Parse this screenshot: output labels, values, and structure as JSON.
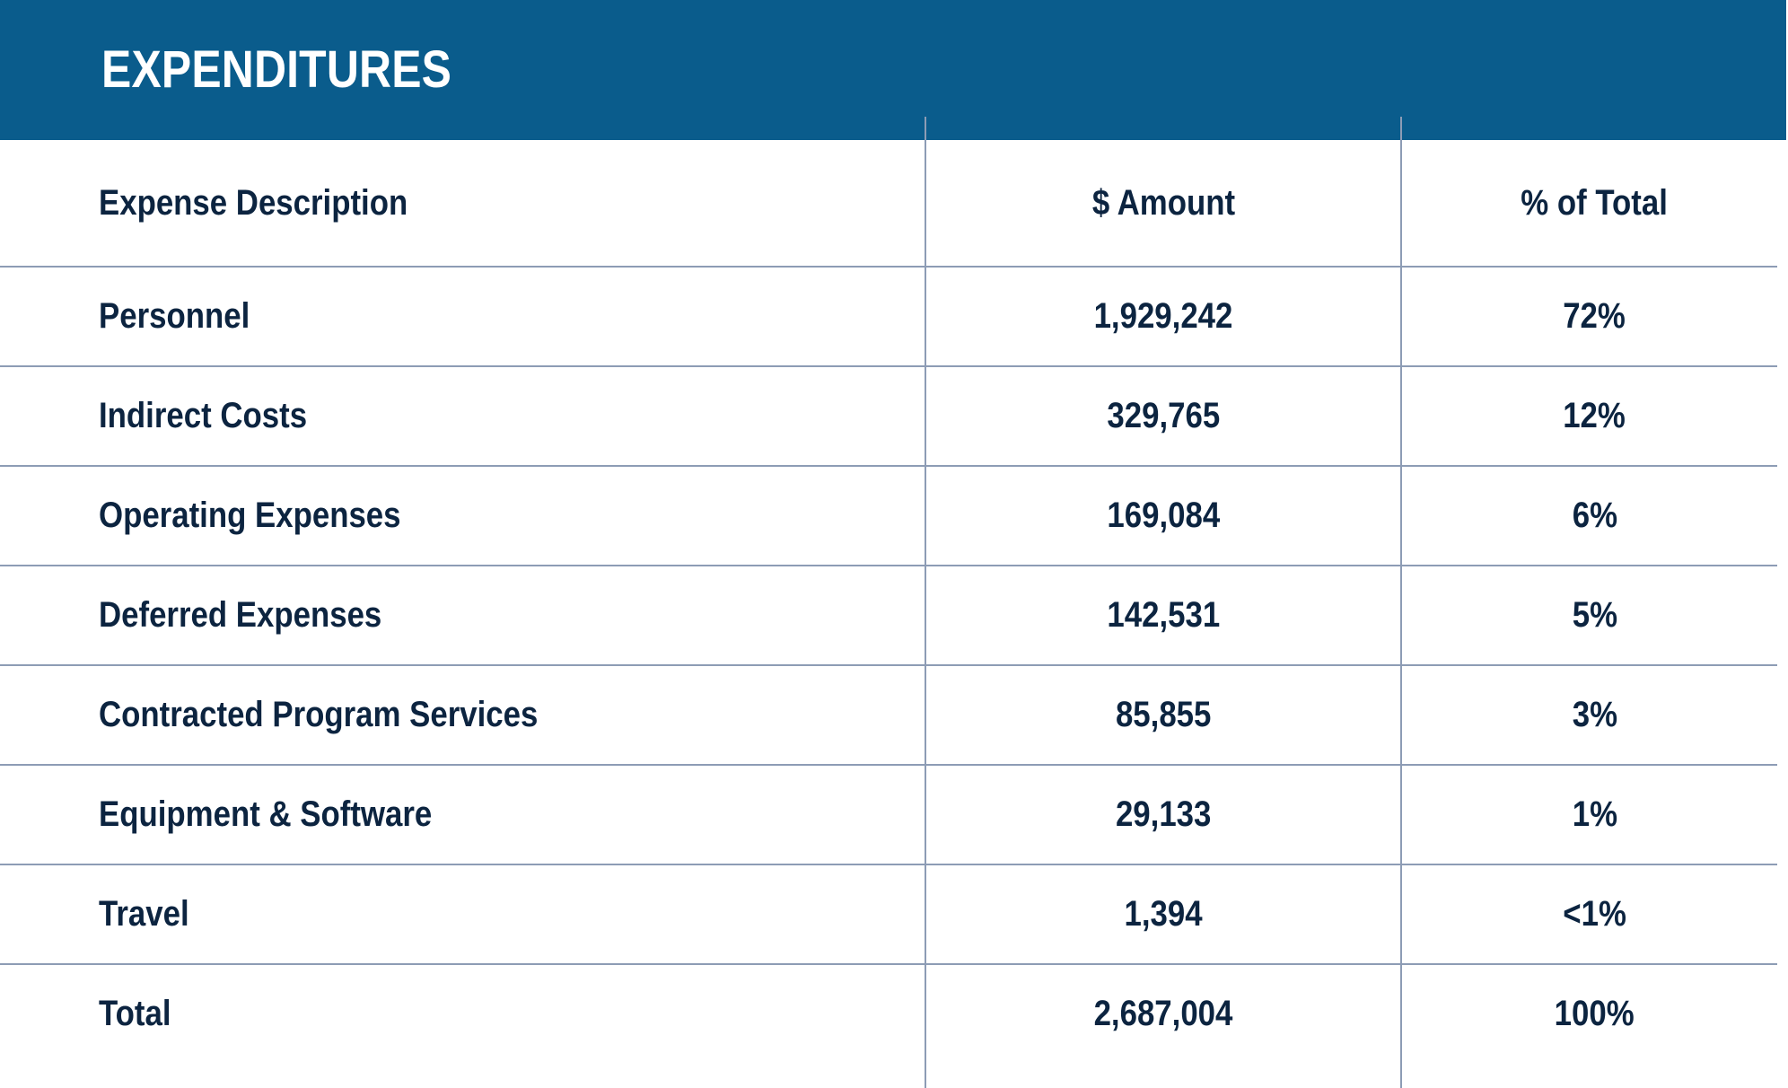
{
  "colors": {
    "brand_blue": "#0a5c8c",
    "navy_text": "#0c2440",
    "rule": "#8d9cb5",
    "page_background": "#ffffff"
  },
  "header": {
    "title": "EXPENDITURES"
  },
  "table": {
    "columns": [
      {
        "key": "description",
        "label": "Expense Description",
        "align": "left"
      },
      {
        "key": "amount",
        "label": "$ Amount",
        "align": "center"
      },
      {
        "key": "percent",
        "label": "% of Total",
        "align": "center"
      }
    ],
    "rows": [
      {
        "description": "Personnel",
        "amount": "1,929,242",
        "percent": "72%"
      },
      {
        "description": "Indirect Costs",
        "amount": "329,765",
        "percent": "12%"
      },
      {
        "description": "Operating Expenses",
        "amount": "169,084",
        "percent": "6%"
      },
      {
        "description": "Deferred Expenses",
        "amount": "142,531",
        "percent": "5%"
      },
      {
        "description": "Contracted Program Services",
        "amount": "85,855",
        "percent": "3%"
      },
      {
        "description": "Equipment & Software",
        "amount": "29,133",
        "percent": "1%"
      },
      {
        "description": "Travel",
        "amount": "1,394",
        "percent": "<1%"
      },
      {
        "description": "Total",
        "amount": "2,687,004",
        "percent": "100%"
      }
    ]
  },
  "chart_data": {
    "type": "table",
    "title": "EXPENDITURES",
    "columns": [
      "Expense Description",
      "$ Amount",
      "% of Total"
    ],
    "rows": [
      [
        "Personnel",
        1929242,
        72
      ],
      [
        "Indirect Costs",
        329765,
        12
      ],
      [
        "Operating Expenses",
        169084,
        6
      ],
      [
        "Deferred Expenses",
        142531,
        5
      ],
      [
        "Contracted Program Services",
        85855,
        3
      ],
      [
        "Equipment & Software",
        29133,
        1
      ],
      [
        "Travel",
        1394,
        0.5
      ],
      [
        "Total",
        2687004,
        100
      ]
    ],
    "total_row_index": 7,
    "units": {
      "amount": "USD",
      "percent": "%"
    }
  }
}
